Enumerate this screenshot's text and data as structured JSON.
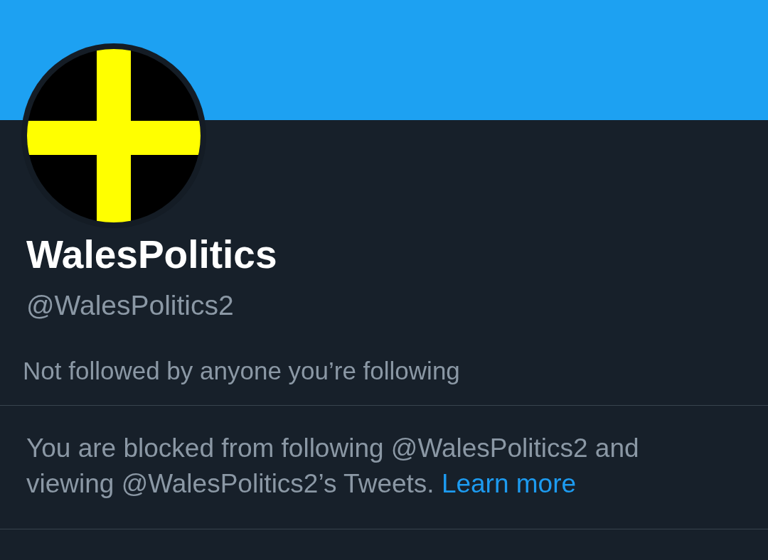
{
  "profile": {
    "name": "WalesPolitics",
    "handle": "@WalesPolitics2"
  },
  "followers_note": "Not followed by anyone you’re following",
  "blocked_notice": {
    "text": "You are blocked from following @WalesPolitics2 and viewing @WalesPolitics2’s Tweets.",
    "link": "Learn more"
  }
}
